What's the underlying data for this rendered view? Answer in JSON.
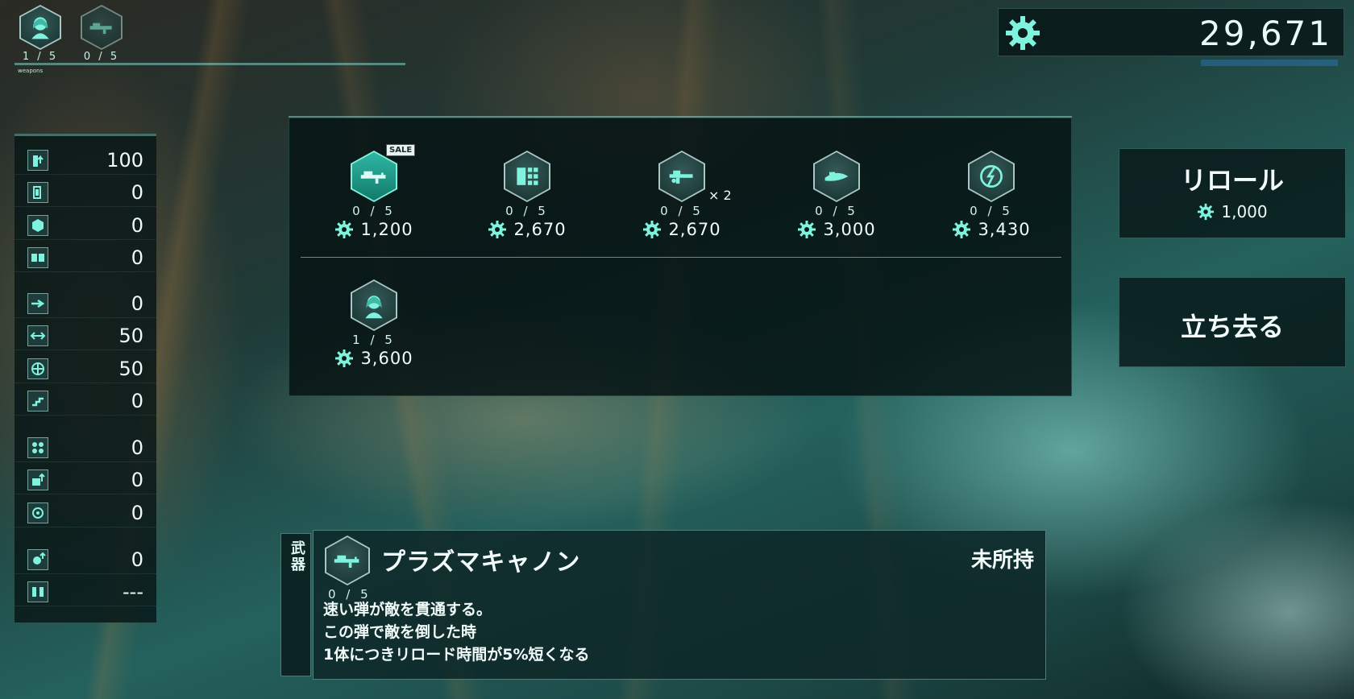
{
  "party": {
    "slots": [
      {
        "count": "1 / 5",
        "icon": "character-portrait-icon"
      },
      {
        "count": "0 / 5",
        "icon": "plasma-cannon-icon"
      }
    ],
    "label": "weapons"
  },
  "currency": {
    "amount": "29,671",
    "icon": "gear-icon"
  },
  "stats": [
    {
      "icon": "attack-up-icon",
      "value": "100"
    },
    {
      "icon": "defense-icon",
      "value": "0"
    },
    {
      "icon": "cube-cluster-icon",
      "value": "0"
    },
    {
      "icon": "robots-icon",
      "value": "0"
    },
    {
      "icon": "dash-icon",
      "value": "0"
    },
    {
      "icon": "range-icon",
      "value": "50"
    },
    {
      "icon": "burst-icon",
      "value": "50"
    },
    {
      "icon": "stairs-icon",
      "value": "0"
    },
    {
      "icon": "multi-shot-icon",
      "value": "0"
    },
    {
      "icon": "box-up-icon",
      "value": "0"
    },
    {
      "icon": "target-icon",
      "value": "0"
    },
    {
      "icon": "gear-up-icon",
      "value": "0"
    },
    {
      "icon": "pair-icon",
      "value": "---"
    }
  ],
  "shop": {
    "items": [
      {
        "icon": "plasma-cannon-icon",
        "stock": "0 / 5",
        "price": "1,200",
        "badge": "SALE",
        "selected": true
      },
      {
        "icon": "module-grid-icon",
        "stock": "0 / 5",
        "price": "2,670"
      },
      {
        "icon": "rifle-icon",
        "stock": "0 / 5",
        "price": "2,670",
        "multiplier": "× 2"
      },
      {
        "icon": "blade-ship-icon",
        "stock": "0 / 5",
        "price": "3,000"
      },
      {
        "icon": "lightning-emblem-icon",
        "stock": "0 / 5",
        "price": "3,430"
      },
      {
        "icon": "character-portrait-icon",
        "stock": "1 / 5",
        "price": "3,600"
      }
    ]
  },
  "buttons": {
    "reroll": {
      "label": "リロール",
      "cost": "1,000"
    },
    "leave": {
      "label": "立ち去る"
    }
  },
  "detail": {
    "tab_label": "武器",
    "name": "プラズマキャノン",
    "stock": "0 / 5",
    "ownership": "未所持",
    "description": [
      "速い弾が敵を貫通する。",
      "この弾で敵を倒した時",
      "1体につきリロード時間が5%短くなる"
    ]
  },
  "colors": {
    "accent": "#7ff3dd",
    "panel": "#0a1c1c"
  }
}
